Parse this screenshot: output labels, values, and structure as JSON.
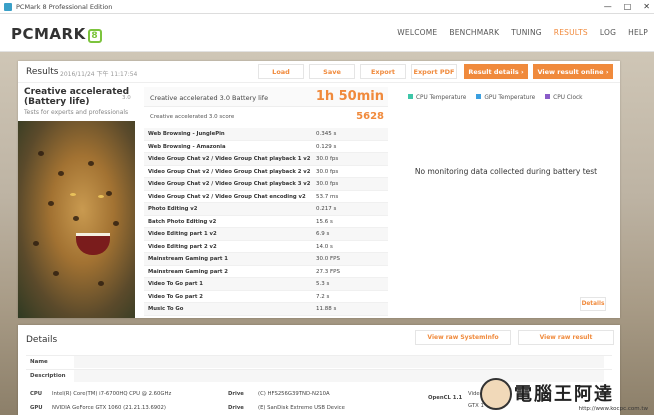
{
  "window": {
    "title": "PCMark 8 Professional Edition"
  },
  "header": {
    "logo_text": "PCMARK",
    "logo_badge": "8",
    "nav": [
      "WELCOME",
      "BENCHMARK",
      "TUNING",
      "RESULTS",
      "LOG",
      "HELP"
    ],
    "active_nav": "RESULTS"
  },
  "results": {
    "title": "Results",
    "date": "2016/11/24 下午 11:17:54",
    "buttons": {
      "load": "Load",
      "save": "Save",
      "export": "Export",
      "export_pdf": "Export PDF",
      "result_details": "Result details",
      "view_online": "View result online"
    },
    "benchmark": {
      "title": "Creative accelerated (Battery life)",
      "version": "3.0",
      "subtitle": "Tests for experts and professionals"
    },
    "score": {
      "battery_label": "Creative accelerated 3.0 Battery life",
      "battery_value": "1h 50min",
      "score_label": "Creative accelerated 3.0 score",
      "score_value": "5628"
    },
    "subtests": [
      {
        "name": "Web Browsing - JunglePin",
        "value": "0.345 s"
      },
      {
        "name": "Web Browsing - Amazonia",
        "value": "0.129 s"
      },
      {
        "name": "Video Group Chat v2 / Video Group Chat playback 1 v2",
        "value": "30.0 fps"
      },
      {
        "name": "Video Group Chat v2 / Video Group Chat playback 2 v2",
        "value": "30.0 fps"
      },
      {
        "name": "Video Group Chat v2 / Video Group Chat playback 3 v2",
        "value": "30.0 fps"
      },
      {
        "name": "Video Group Chat v2 / Video Group Chat encoding v2",
        "value": "53.7 ms"
      },
      {
        "name": "Photo Editing v2",
        "value": "0.217 s"
      },
      {
        "name": "Batch Photo Editing v2",
        "value": "15.6 s"
      },
      {
        "name": "Video Editing part 1 v2",
        "value": "6.9 s"
      },
      {
        "name": "Video Editing part 2 v2",
        "value": "14.0 s"
      },
      {
        "name": "Mainstream Gaming part 1",
        "value": "30.0 FPS"
      },
      {
        "name": "Mainstream Gaming part 2",
        "value": "27.3 FPS"
      },
      {
        "name": "Video To Go part 1",
        "value": "5.3 s"
      },
      {
        "name": "Video To Go part 2",
        "value": "7.2 s"
      },
      {
        "name": "Music To Go",
        "value": "11.88 s"
      }
    ],
    "monitoring": {
      "legend": [
        {
          "label": "CPU Temperature",
          "color": "#3ec6a8"
        },
        {
          "label": "GPU Temperature",
          "color": "#3a9fe0"
        },
        {
          "label": "CPU Clock",
          "color": "#8a5cc8"
        }
      ],
      "no_data": "No monitoring data collected during battery test",
      "details_button": "Details"
    }
  },
  "details": {
    "title": "Details",
    "view_sysinfo": "View raw SystemInfo",
    "view_result": "View raw result",
    "name_label": "Name",
    "description_label": "Description",
    "cpu_label": "CPU",
    "cpu_value": "Intel(R) Core(TM) i7-6700HQ CPU @ 2.60GHz",
    "gpu_label": "GPU",
    "gpu_value": "NVIDIA GeForce GTX 1060 (21.21.13.6902)",
    "drive_label": "Drive",
    "drive_value": "(C) HFS256G39TND-N210A",
    "drive2_label": "Drive",
    "drive2_value": "(E) SanDisk Extreme USB Device",
    "opencl_label": "OpenCL 1.1",
    "opencl_value": "Video",
    "opencl_value2": "GTX 1"
  },
  "watermark": {
    "text": "電腦王阿達",
    "url": "http://www.kocpc.com.tw"
  }
}
